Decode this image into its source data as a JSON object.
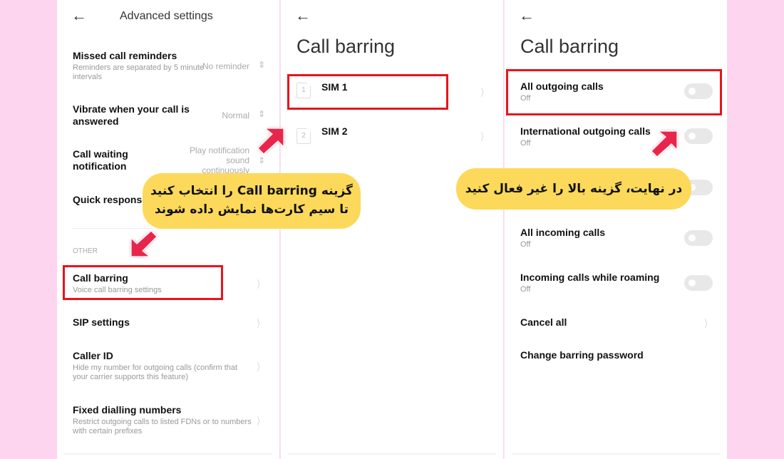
{
  "colors": {
    "background": "#fdd5ef",
    "highlight": "#e8141b",
    "callout": "#fcd95a",
    "arrow": "#e8284c"
  },
  "panel1": {
    "back_icon": "arrow-left-icon",
    "title": "Advanced settings",
    "items": [
      {
        "title": "Missed call reminders",
        "subtitle": "Reminders are separated by 5 minute intervals",
        "value": "No reminder"
      },
      {
        "title": "Vibrate when your call is answered",
        "subtitle": "",
        "value": "Normal"
      },
      {
        "title": "Call waiting notification",
        "subtitle": "",
        "value": "Play notification sound continuously"
      },
      {
        "title": "Quick responses",
        "subtitle": "",
        "value": ""
      }
    ],
    "section_label": "OTHER",
    "other_items": [
      {
        "title": "Call barring",
        "subtitle": "Voice call barring settings"
      },
      {
        "title": "SIP settings",
        "subtitle": ""
      },
      {
        "title": "Caller ID",
        "subtitle": "Hide my number for outgoing calls (confirm that your carrier supports this feature)"
      },
      {
        "title": "Fixed dialling numbers",
        "subtitle": "Restrict outgoing calls to listed FDNs or to numbers with certain prefixes"
      }
    ]
  },
  "panel2": {
    "title": "Call barring",
    "sims": [
      {
        "number": "1",
        "label": "SIM 1"
      },
      {
        "number": "2",
        "label": "SIM 2"
      }
    ]
  },
  "panel3": {
    "title": "Call barring",
    "toggles": [
      {
        "title": "All outgoing calls",
        "status": "Off",
        "on": false
      },
      {
        "title": "International outgoing calls",
        "status": "Off",
        "on": false
      },
      {
        "title": "",
        "status": "",
        "on": false
      },
      {
        "title": "All incoming calls",
        "status": "Off",
        "on": false
      },
      {
        "title": "Incoming calls while roaming",
        "status": "Off",
        "on": false
      }
    ],
    "cancel_all": "Cancel all",
    "change_password": "Change barring password"
  },
  "callouts": {
    "first_line1": "گزینه Call barring را انتخاب کنید",
    "first_line2": "تا سیم کارت‌ها نمایش داده شوند",
    "second": "در نهایت، گزینه بالا را غیر فعال کنید"
  }
}
